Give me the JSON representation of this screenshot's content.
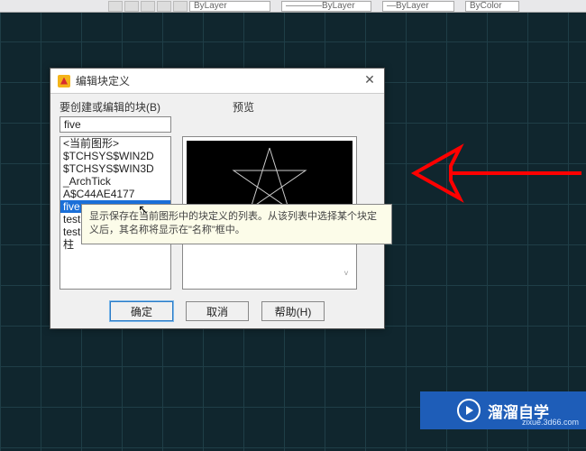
{
  "toolbar": {
    "layer": "ByLayer",
    "prop1": "ByLayer",
    "prop2": "ByLayer",
    "prop3": "ByColor"
  },
  "dialog": {
    "title": "编辑块定义",
    "label_block": "要创建或编辑的块(B)",
    "input_value": "five",
    "label_preview": "预览",
    "list": {
      "items": [
        "<当前图形>",
        "$TCHSYS$WIN2D",
        "$TCHSYS$WIN3D",
        "_ArchTick",
        "A$C44AE4177",
        "five",
        "test",
        "test",
        "柱"
      ],
      "selected_index": 5
    },
    "tooltip_text": "显示保存在当前图形中的块定义的列表。从该列表中选择某个块定义后，其名称将显示在\"名称\"框中。",
    "buttons": {
      "ok": "确定",
      "cancel": "取消",
      "help": "帮助(H)"
    }
  },
  "watermark": {
    "brand": "溜溜自学",
    "url": "zixue.3d66.com"
  }
}
